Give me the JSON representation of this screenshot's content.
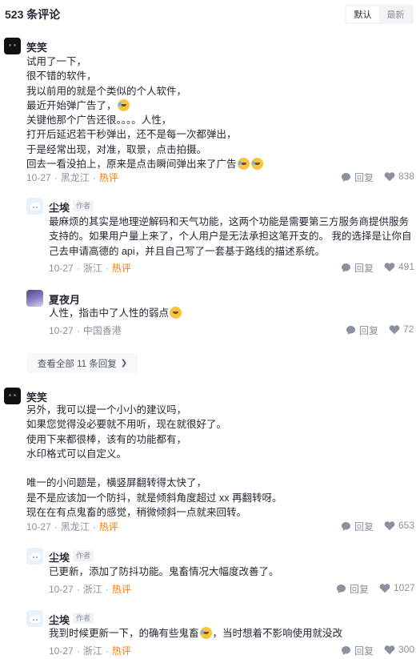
{
  "header": {
    "title": "523 条评论",
    "sort_default": "默认",
    "sort_latest": "最新"
  },
  "threads": [
    {
      "user": "笑笑",
      "lines": [
        "试用了一下，",
        "很不错的软件，",
        "我以前用的就是个类似的个人软件，",
        "最近开始弹广告了，",
        "关键他那个广告还很。。。。人性，",
        "打开后延迟若干秒弹出，还不是每一次都弹出，",
        "于是经常出现，对准，取景，点击拍摄。",
        "回去一看没拍上，原来是点击瞬间弹出来了广告"
      ],
      "date": "10-27",
      "location": "黑龙江",
      "hot": "热评",
      "reply_label": "回复",
      "likes": "838",
      "replies": [
        {
          "user": "尘埃",
          "tag": "作者",
          "text": "最麻烦的其实是地理逆解码和天气功能，这两个功能是需要第三方服务商提供服务支持的。如果用户量上来了，个人用户是无法承担这笔开支的。 我的选择是让你自己去申请高德的 api，并且自己写了一套基于路线的描述系统。",
          "date": "10-27",
          "location": "浙江",
          "hot": "热评",
          "reply_label": "回复",
          "likes": "491"
        },
        {
          "user": "夏夜月",
          "text": "人性，指击中了人性的弱点",
          "date": "10-27",
          "location": "中国香港",
          "reply_label": "回复",
          "likes": "72"
        }
      ],
      "more_replies": "查看全部 11 条回复"
    },
    {
      "user": "笑笑",
      "lines": [
        "另外，我可以提一个小小的建议吗，",
        "如果您觉得没必要就不用听，现在就很好了。",
        "使用下来都很棒，该有的功能都有，",
        "水印格式可以自定义。",
        "",
        "唯一的小问题是，横竖屏翻转得太快了，",
        "是不是应该加一个防抖，就是倾斜角度超过 xx 再翻转呀。",
        "现在在有点鬼畜的感觉，稍微倾斜一点就来回转。"
      ],
      "date": "10-27",
      "location": "黑龙江",
      "hot": "热评",
      "reply_label": "回复",
      "likes": "653",
      "replies": [
        {
          "user": "尘埃",
          "tag": "作者",
          "text": "已更新，添加了防抖功能。鬼畜情况大幅度改善了。",
          "date": "10-27",
          "location": "浙江",
          "hot": "热评",
          "reply_label": "回复",
          "likes": "1027"
        },
        {
          "user": "尘埃",
          "tag": "作者",
          "text_a": "我到时候更新一下，的确有些鬼畜",
          "text_b": "，当时想着不影响使用就没改",
          "date": "10-27",
          "location": "浙江",
          "hot": "热评",
          "reply_label": "回复",
          "likes": "300"
        }
      ]
    }
  ],
  "icons": {
    "reply": "comment-bubble-icon",
    "like": "heart-icon",
    "emoji_laugh_tears": "laughing-tears-emoji",
    "emoji_rofl": "rofl-emoji"
  },
  "colors": {
    "hot": "#ff7d00",
    "meta": "#8a919f",
    "text": "#252933"
  }
}
